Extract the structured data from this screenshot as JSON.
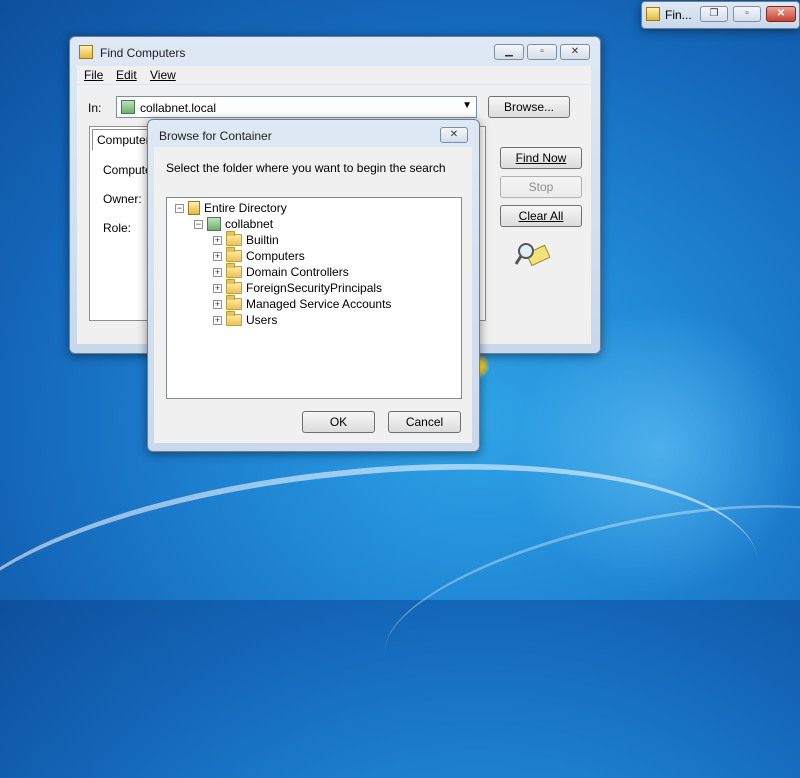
{
  "taskbar_mini": {
    "title": "Fin..."
  },
  "find_window": {
    "title": "Find Computers",
    "menu": [
      "File",
      "Edit",
      "View"
    ],
    "in_label": "In:",
    "in_value": "collabnet.local",
    "browse_button": "Browse...",
    "tab_label": "Computers",
    "fields": [
      "Compute",
      "Owner:",
      "Role:"
    ],
    "buttons": {
      "find_now": "Find Now",
      "stop": "Stop",
      "clear_all": "Clear All"
    }
  },
  "browse_dialog": {
    "title": "Browse for Container",
    "instruction": "Select the folder where you want to begin the search",
    "tree": {
      "root": "Entire Directory",
      "domain": "collabnet",
      "children": [
        "Builtin",
        "Computers",
        "Domain Controllers",
        "ForeignSecurityPrincipals",
        "Managed Service Accounts",
        "Users"
      ]
    },
    "ok_button": "OK",
    "cancel_button": "Cancel"
  }
}
